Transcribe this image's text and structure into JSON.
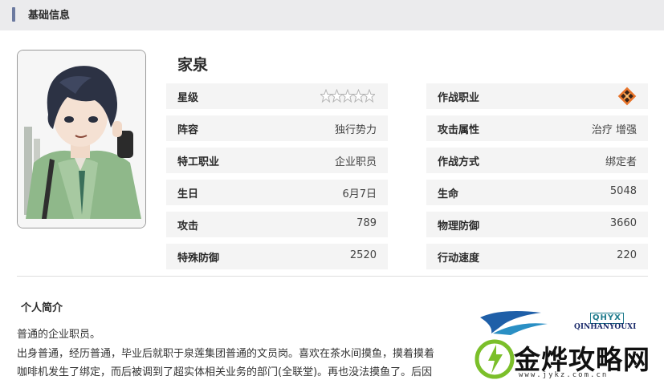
{
  "header": {
    "title": "基础信息"
  },
  "character": {
    "name": "家泉",
    "portrait_icon": "character-portrait",
    "stars": 5
  },
  "stats_left": [
    {
      "label": "星级",
      "value": ""
    },
    {
      "label": "阵容",
      "value": "独行势力"
    },
    {
      "label": "特工职业",
      "value": "企业职员"
    },
    {
      "label": "生日",
      "value": "6月7日"
    },
    {
      "label": "攻击",
      "value": "789"
    },
    {
      "label": "特殊防御",
      "value": "2520"
    }
  ],
  "stats_right": [
    {
      "label": "作战职业",
      "value": ""
    },
    {
      "label": "攻击属性",
      "value": "治疗 增强"
    },
    {
      "label": "作战方式",
      "value": "绑定者"
    },
    {
      "label": "生命",
      "value": "5048"
    },
    {
      "label": "物理防御",
      "value": "3660"
    },
    {
      "label": "行动速度",
      "value": "220"
    }
  ],
  "intro": {
    "title": "个人简介",
    "lines": [
      "普通的企业职员。",
      "出身普通，经历普通，毕业后就职于泉莲集团普通的文员岗。喜欢在茶水间摸鱼，摸着摸着",
      "咖啡机发生了绑定，而后被调到了超实体相关业务的部门(全联堂)。再也没法摸鱼了。后因"
    ]
  },
  "watermark": {
    "box_text": "QHYX",
    "sub_text": "QINHANYOUXI",
    "main_text": "金烨攻略网",
    "url": "www.jykz.com.cn"
  },
  "colors": {
    "header_bg": "#ebebed",
    "accent_bar": "#6c7aa0",
    "row_bg": "#f4f4f4",
    "role_icon": "#e8742a"
  }
}
